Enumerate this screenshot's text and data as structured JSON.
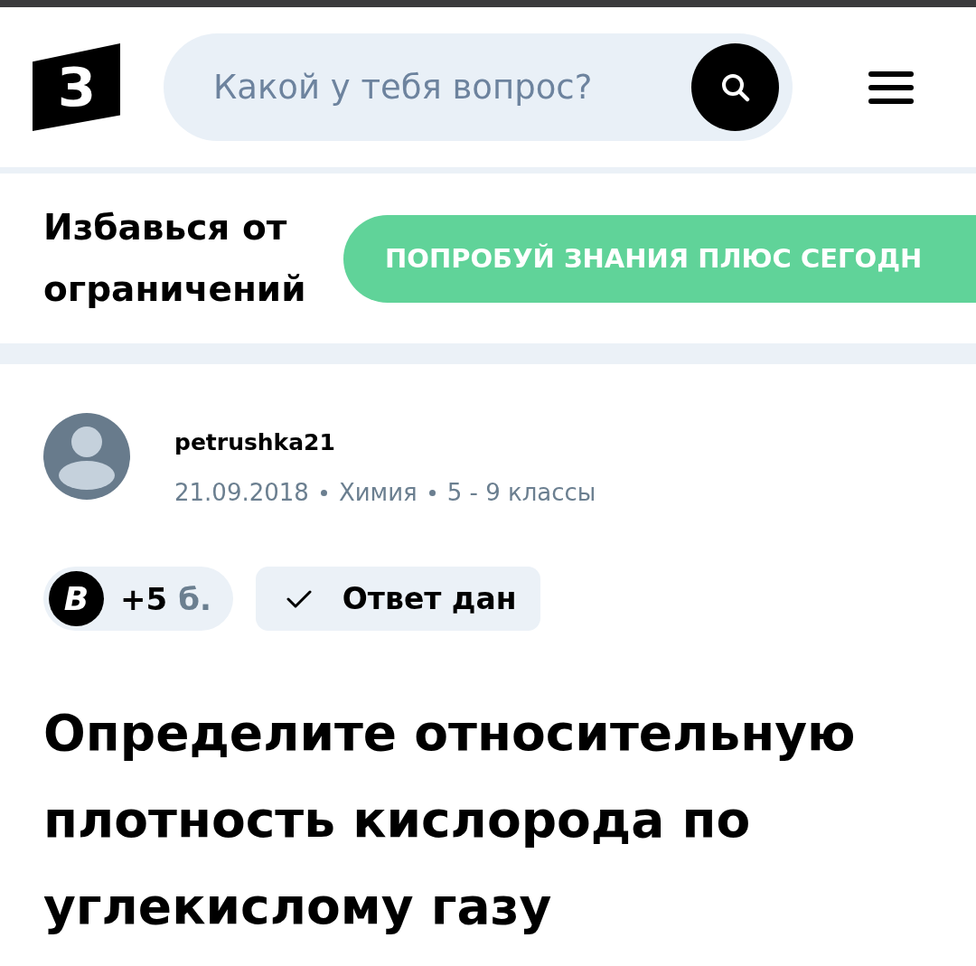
{
  "header": {
    "logo": "З",
    "search": {
      "placeholder": "Какой у тебя вопрос?"
    }
  },
  "promo": {
    "text": "Избавься от ограничений",
    "button": "ПОПРОБУЙ ЗНАНИЯ ПЛЮС СЕГОДН"
  },
  "question": {
    "author": "petrushka21",
    "meta": [
      "21.09.2018",
      "Химия",
      "5 - 9 классы"
    ],
    "points": {
      "icon": "B",
      "value": "+5",
      "unit": "б."
    },
    "status": "Ответ дан",
    "title": "Определите относительную плотность кислорода по углекислому газу"
  }
}
